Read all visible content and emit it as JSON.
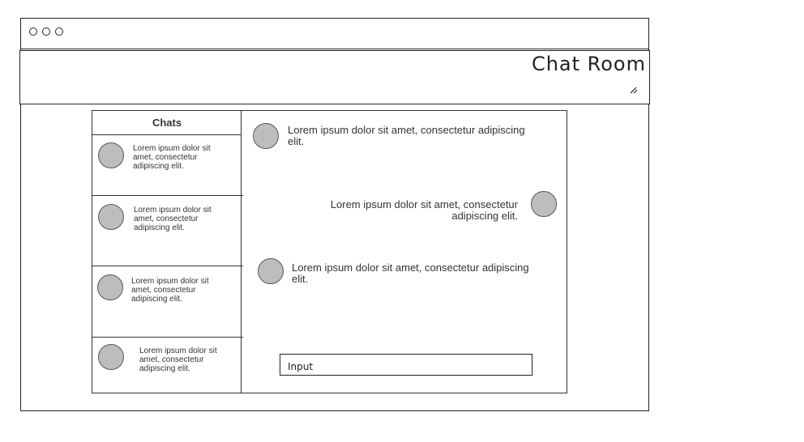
{
  "window": {
    "title_dots": [
      "dot-1",
      "dot-2",
      "dot-3"
    ]
  },
  "header": {
    "title": "Chat Room",
    "resize_icon": "resize-icon"
  },
  "sidebar": {
    "title": "Chats",
    "chats": [
      {
        "preview": "Lorem ipsum dolor sit amet, consectetur adipiscing elit."
      },
      {
        "preview": "Lorem ipsum dolor sit amet, consectetur adipiscing elit."
      },
      {
        "preview": "Lorem ipsum dolor sit amet, consectetur adipiscing elit."
      },
      {
        "preview": "Lorem ipsum dolor sit amet, consectetur adipiscing elit."
      }
    ]
  },
  "messages": [
    {
      "text": "Lorem ipsum dolor sit amet, consectetur adipiscing elit.",
      "side": "left"
    },
    {
      "text": "Lorem ipsum dolor sit amet, consectetur adipiscing elit.",
      "side": "right"
    },
    {
      "text": "Lorem ipsum dolor sit amet, consectetur adipiscing elit.",
      "side": "left"
    }
  ],
  "composer": {
    "placeholder": "Input"
  },
  "colors": {
    "avatar": "#bdbdbd",
    "border": "#222222"
  }
}
